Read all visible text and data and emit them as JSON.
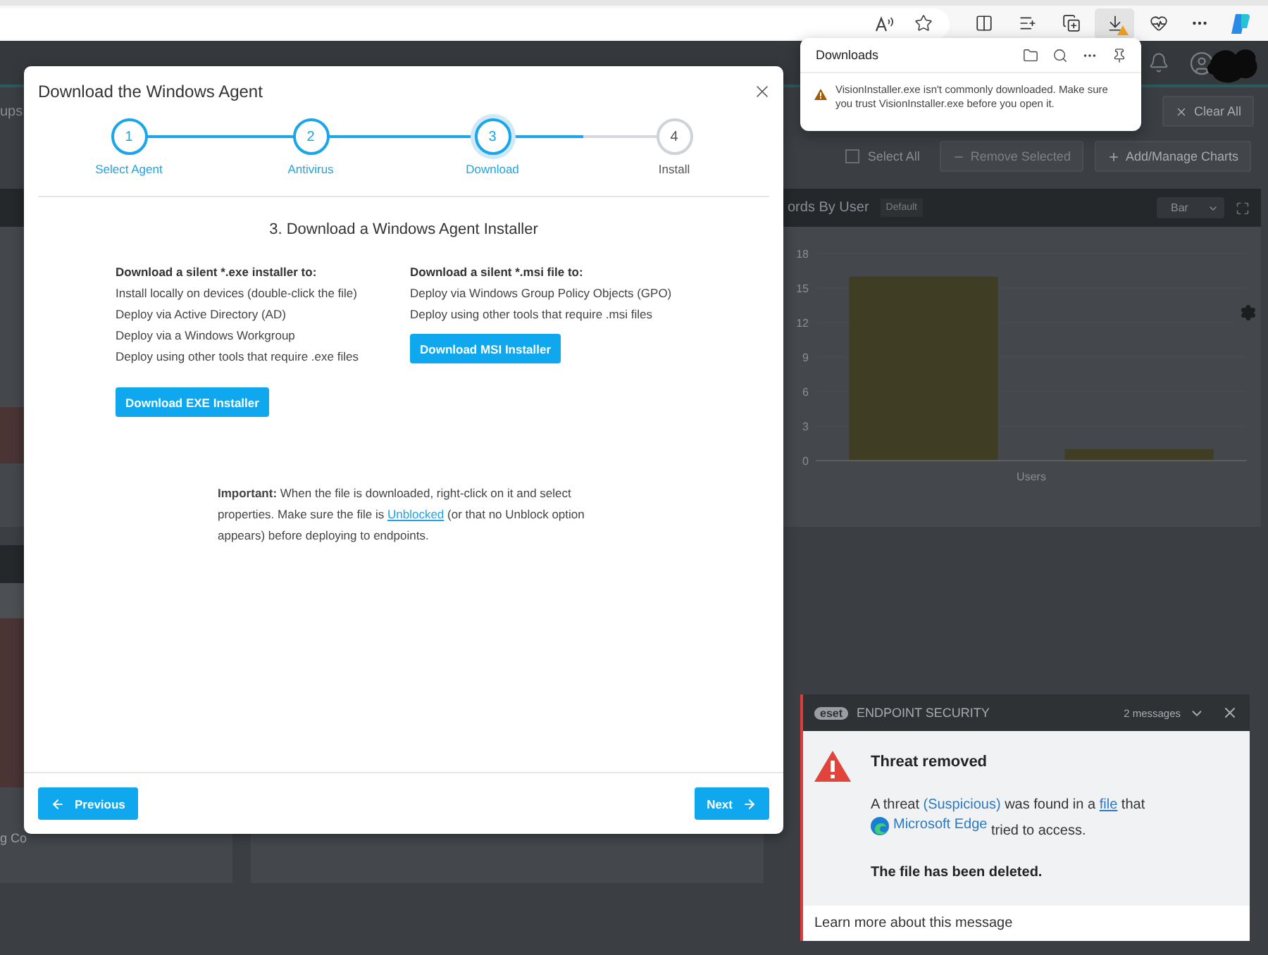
{
  "downloads_panel": {
    "title": "Downloads",
    "message": "VisionInstaller.exe isn't commonly downloaded. Make sure you trust VisionInstaller.exe before you open it."
  },
  "dashboard": {
    "tab_fragment": "ups",
    "clear_button": "Clear All",
    "select_all": {
      "label": "Select All",
      "checked": false
    },
    "remove_button": {
      "label": "Remove Selected",
      "disabled": true
    },
    "add_button": "Add/Manage Charts",
    "chart_card": {
      "title": "ords By User",
      "badge": "Default",
      "chart_type": "Bar",
      "chart_data": {
        "type": "bar",
        "xlabel": "Users",
        "values": [
          16,
          1
        ],
        "ylim": [
          0,
          18
        ],
        "yticks": [
          0,
          3,
          6,
          9,
          12,
          15,
          18
        ],
        "color": "#3f3e24"
      }
    },
    "card_fragment": "g Co"
  },
  "modal": {
    "title": "Download the Windows Agent",
    "steps": [
      {
        "number": "1",
        "label": "Select Agent",
        "reached": true,
        "current": false
      },
      {
        "number": "2",
        "label": "Antivirus",
        "reached": true,
        "current": false
      },
      {
        "number": "3",
        "label": "Download",
        "reached": true,
        "current": true
      },
      {
        "number": "4",
        "label": "Install",
        "reached": false,
        "current": false
      }
    ],
    "heading": "3. Download a Windows Agent Installer",
    "columns": [
      {
        "title": "Download a silent *.exe installer to:",
        "items": [
          "Install locally on devices (double-click the file)",
          "Deploy via Active Directory (AD)",
          "Deploy via a Windows Workgroup",
          "Deploy using other tools that require .exe files"
        ],
        "button": "Download EXE Installer"
      },
      {
        "title": "Download a silent *.msi file to:",
        "items": [
          "Deploy via Windows Group Policy Objects (GPO)",
          "Deploy using other tools that require .msi files"
        ],
        "button": "Download MSI Installer"
      }
    ],
    "note": {
      "before": "**Important:** When the file is downloaded, right-click on it and select properties. Make sure the file is",
      "link": "Unblocked",
      "after": "(or that no Unblock option appears) before deploying to endpoints."
    },
    "previous_button": "Previous",
    "next_button": "Next"
  },
  "toast": {
    "brand": "eset",
    "product": "ENDPOINT SECURITY",
    "count": "2 messages",
    "title": "Threat removed",
    "message": {
      "start": "A threat",
      "threat": "(Suspicious)",
      "middle": "was found in a",
      "link": "file",
      "after": "that",
      "app": "Microsoft Edge",
      "end": "tried to access."
    },
    "result": "The file has been deleted.",
    "footer": "Learn more about this message"
  }
}
